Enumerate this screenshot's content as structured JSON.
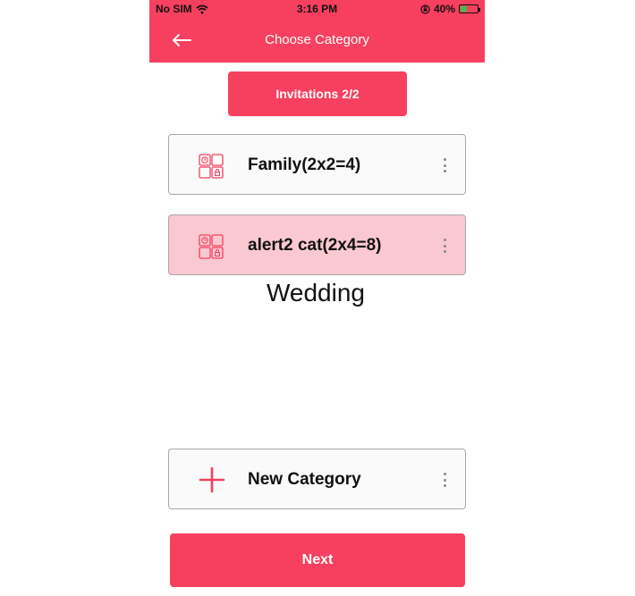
{
  "status_bar": {
    "carrier": "No SIM",
    "time": "3:16 PM",
    "battery_percent": "40%",
    "battery_level": 0.4,
    "icons": [
      "wifi-icon",
      "orientation-lock-icon",
      "battery-icon"
    ]
  },
  "header": {
    "title": "Choose Category",
    "back_icon": "arrow-left-icon"
  },
  "tab": {
    "label": "Invitations 2/2"
  },
  "categories": [
    {
      "label": "Family(2x2=4)",
      "icon": "category-grid-icon",
      "selected": false
    },
    {
      "label": "alert2 cat(2x4=8)",
      "icon": "category-grid-icon",
      "selected": true
    }
  ],
  "overlay_text": "Wedding",
  "new_category": {
    "label": "New Category",
    "icon": "plus-icon"
  },
  "next_button": {
    "label": "Next"
  },
  "colors": {
    "accent": "#F7405F",
    "selected_card": "#FAC8D1",
    "card_border": "#A8A8A8"
  }
}
